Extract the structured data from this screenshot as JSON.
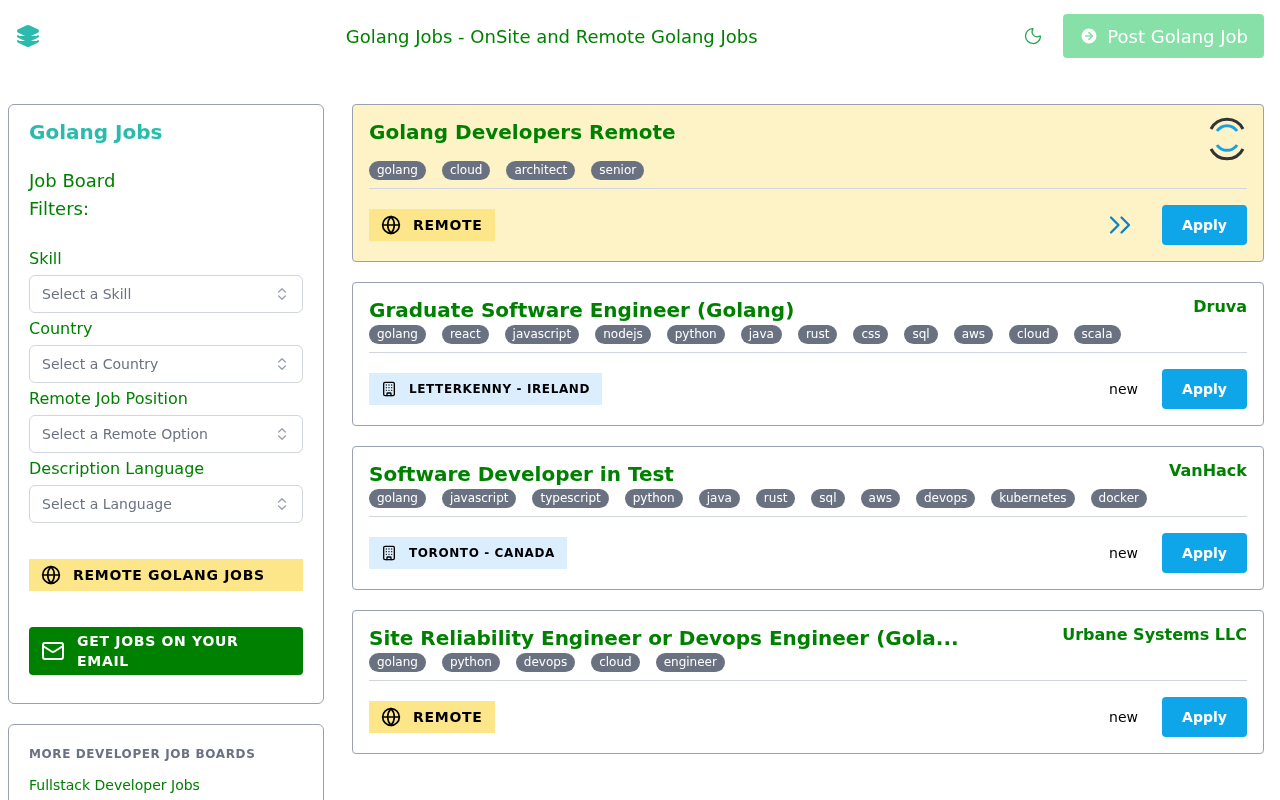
{
  "header": {
    "title": "Golang Jobs - OnSite and Remote Golang Jobs",
    "post_button": "Post Golang Job"
  },
  "sidebar": {
    "title": "Golang Jobs",
    "subtitle": "Job Board\nFilters:",
    "filters": [
      {
        "label": "Skill",
        "placeholder": "Select a Skill"
      },
      {
        "label": "Country",
        "placeholder": "Select a Country"
      },
      {
        "label": "Remote Job Position",
        "placeholder": "Select a Remote Option"
      },
      {
        "label": "Description Language",
        "placeholder": "Select a Language"
      }
    ],
    "remote_button": "REMOTE GOLANG JOBS",
    "email_button": "GET JOBS ON YOUR EMAIL",
    "more_title": "MORE DEVELOPER JOB BOARDS",
    "more_links": [
      "Fullstack Developer Jobs"
    ]
  },
  "jobs": [
    {
      "kind": "featured",
      "title": "Golang Developers Remote",
      "tags": [
        "golang",
        "cloud",
        "architect",
        "senior"
      ],
      "location": {
        "kind": "remote",
        "text": "REMOTE"
      },
      "apply": "Apply"
    },
    {
      "kind": "regular",
      "title": "Graduate Software Engineer (Golang)",
      "company": "Druva",
      "tags": [
        "golang",
        "react",
        "javascript",
        "nodejs",
        "python",
        "java",
        "rust",
        "css",
        "sql",
        "aws",
        "cloud",
        "scala"
      ],
      "location": {
        "kind": "office",
        "text": "LETTERKENNY - IRELAND"
      },
      "badge": "new",
      "apply": "Apply"
    },
    {
      "kind": "regular",
      "title": "Software Developer in Test",
      "company": "VanHack",
      "tags": [
        "golang",
        "javascript",
        "typescript",
        "python",
        "java",
        "rust",
        "sql",
        "aws",
        "devops",
        "kubernetes",
        "docker"
      ],
      "location": {
        "kind": "office",
        "text": "TORONTO - CANADA"
      },
      "badge": "new",
      "apply": "Apply"
    },
    {
      "kind": "regular",
      "title": "Site Reliability Engineer or Devops Engineer (Gola...",
      "company": "Urbane Systems LLC",
      "tags": [
        "golang",
        "python",
        "devops",
        "cloud",
        "engineer"
      ],
      "location": {
        "kind": "remote",
        "text": "REMOTE"
      },
      "badge": "new",
      "apply": "Apply"
    }
  ]
}
